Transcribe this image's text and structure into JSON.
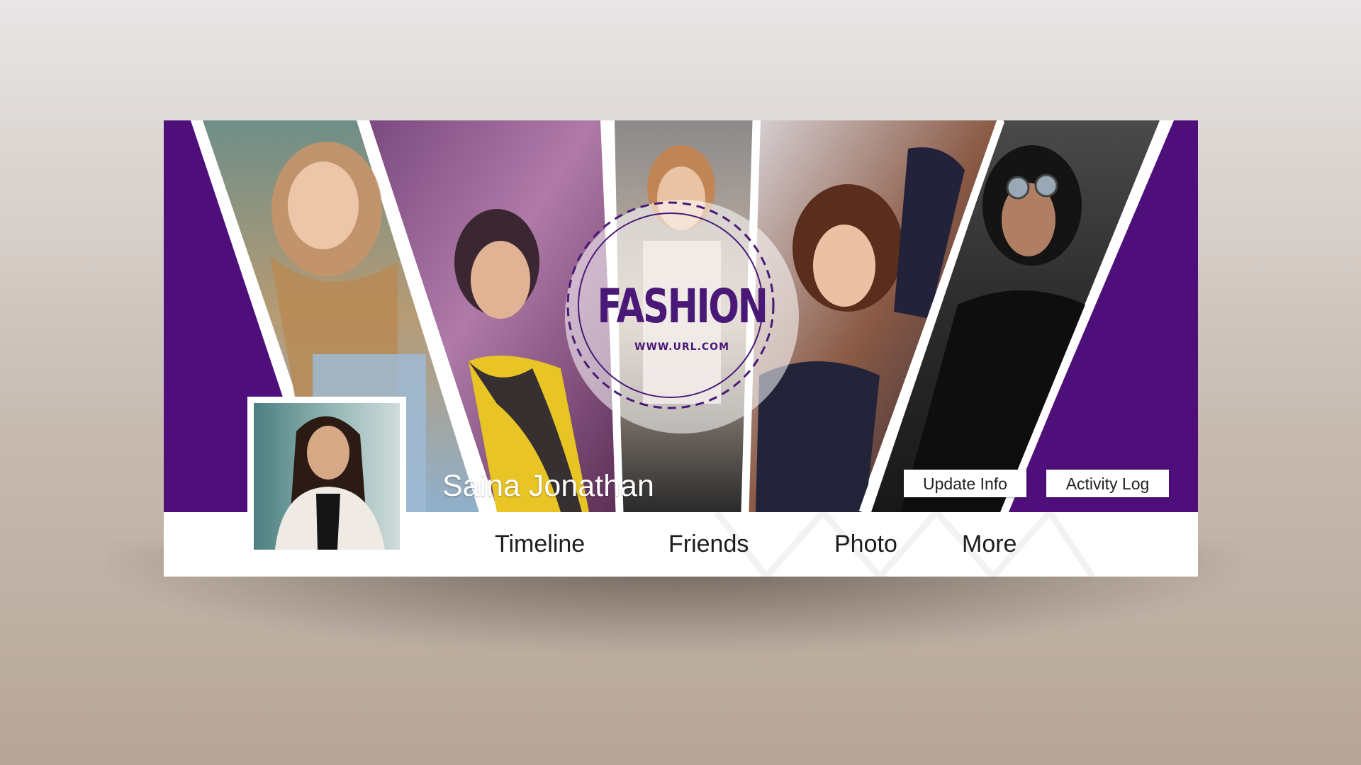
{
  "profile": {
    "name": "Saina Jonathan"
  },
  "brand": {
    "title": "FASHION",
    "url": "WWW.URL.COM"
  },
  "actions": {
    "update_info": "Update Info",
    "activity_log": "Activity Log"
  },
  "nav": {
    "items": [
      {
        "label": "Timeline"
      },
      {
        "label": "Friends"
      },
      {
        "label": "Photo"
      },
      {
        "label": "More"
      }
    ]
  },
  "colors": {
    "accent_purple": "#4f0f7b",
    "brand_text": "#4a1877",
    "panel_white": "#ffffff"
  },
  "icons": {
    "badge": "dashed-circle-emblem"
  }
}
